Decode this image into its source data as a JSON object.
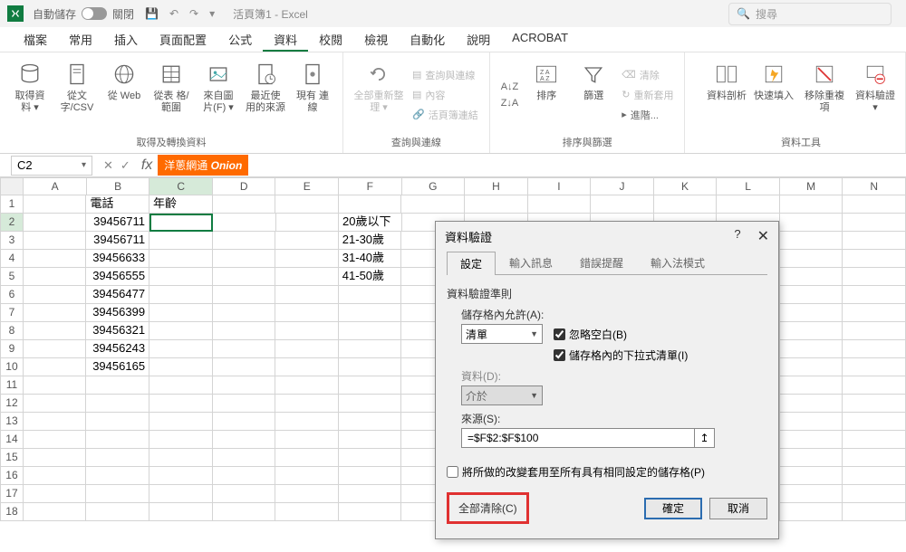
{
  "titlebar": {
    "autosave_label": "自動儲存",
    "autosave_state": "關閉",
    "doc_title": "活頁簿1 - Excel",
    "search_placeholder": "搜尋"
  },
  "tabs": {
    "file": "檔案",
    "home": "常用",
    "insert": "插入",
    "layout": "頁面配置",
    "formulas": "公式",
    "data": "資料",
    "review": "校閱",
    "view": "檢視",
    "automate": "自動化",
    "help": "說明",
    "acrobat": "ACROBAT"
  },
  "ribbon": {
    "get_data": "取得資\n料 ▾",
    "from_text": "從文\n字/CSV",
    "from_web": "從\nWeb",
    "from_table": "從表\n格/範圍",
    "from_pic": "來自圖\n片(F) ▾",
    "recent": "最近使\n用的來源",
    "existing": "現有\n連線",
    "grp_get": "取得及轉換資料",
    "refresh_all": "全部重新整理\n▾",
    "queries": "查詢與連線",
    "properties": "內容",
    "edit_links": "活頁簿連結",
    "grp_queries": "查詢與連線",
    "sort_az": "A↓Z",
    "sort_za": "Z↓A",
    "sort": "排序",
    "filter": "篩選",
    "clear": "清除",
    "reapply": "重新套用",
    "advanced": "進階...",
    "grp_sort": "排序與篩選",
    "text_to_col": "資料剖析",
    "flash_fill": "快速填入",
    "remove_dup": "移除重複項",
    "data_val": "資料驗證\n▾",
    "grp_tools": "資料工具"
  },
  "namebox": "C2",
  "onion_label_zh": "洋蔥網通",
  "onion_label_en": "Onion",
  "columns": [
    "A",
    "B",
    "C",
    "D",
    "E",
    "F",
    "G",
    "H",
    "I",
    "J",
    "K",
    "L",
    "M",
    "N"
  ],
  "row_count": 18,
  "selected_row": 2,
  "selected_col_index": 2,
  "grid": {
    "B1": "電話",
    "C1": "年齡",
    "B2": "39456711",
    "B3": "39456711",
    "B4": "39456633",
    "B5": "39456555",
    "B6": "39456477",
    "B7": "39456399",
    "B8": "39456321",
    "B9": "39456243",
    "B10": "39456165",
    "F2": "20歲以下",
    "F3": "21-30歲",
    "F4": "31-40歲",
    "F5": "41-50歲"
  },
  "text_cells": [
    "B1",
    "C1",
    "F2",
    "F3",
    "F4",
    "F5"
  ],
  "dialog": {
    "title": "資料驗證",
    "tabs": {
      "settings": "設定",
      "input": "輸入訊息",
      "error": "錯誤提醒",
      "ime": "輸入法模式"
    },
    "criteria_label": "資料驗證準則",
    "allow_label": "儲存格內允許(A):",
    "allow_value": "清單",
    "data_label": "資料(D):",
    "data_value": "介於",
    "ignore_blank": "忽略空白(B)",
    "incell_dropdown": "儲存格內的下拉式清單(I)",
    "source_label": "來源(S):",
    "source_value": "=$F$2:$F$100",
    "apply_same": "將所做的改變套用至所有具有相同設定的儲存格(P)",
    "clear_all": "全部清除(C)",
    "ok": "確定",
    "cancel": "取消"
  }
}
